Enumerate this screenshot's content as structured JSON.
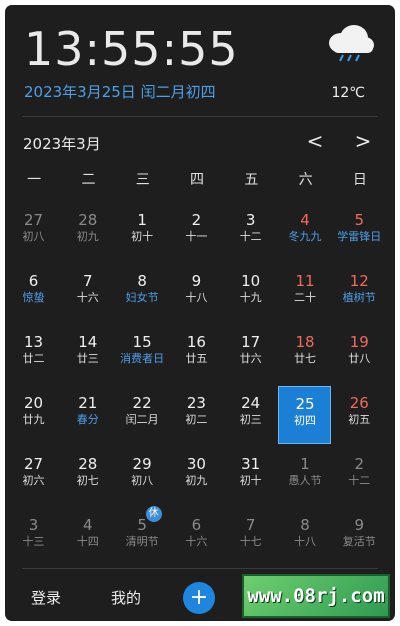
{
  "header": {
    "time": "13:55:55",
    "date": "2023年3月25日 闰二月初四",
    "temperature": "12℃",
    "weather_icon": "cloud-rain-icon"
  },
  "calendar": {
    "month_title": "2023年3月",
    "prev": "<",
    "next": ">",
    "weekdays": [
      "一",
      "二",
      "三",
      "四",
      "五",
      "六",
      "日"
    ],
    "weeks": [
      [
        {
          "d": "27",
          "l": "初八",
          "other": true
        },
        {
          "d": "28",
          "l": "初九",
          "other": true
        },
        {
          "d": "1",
          "l": "初十"
        },
        {
          "d": "2",
          "l": "十一"
        },
        {
          "d": "3",
          "l": "十二"
        },
        {
          "d": "4",
          "l": "冬九九",
          "weekend": true,
          "hl": true
        },
        {
          "d": "5",
          "l": "学雷锋日",
          "weekend": true,
          "hl": true
        }
      ],
      [
        {
          "d": "6",
          "l": "惊蛰",
          "hl": true
        },
        {
          "d": "7",
          "l": "十六"
        },
        {
          "d": "8",
          "l": "妇女节",
          "hl": true
        },
        {
          "d": "9",
          "l": "十八"
        },
        {
          "d": "10",
          "l": "十九"
        },
        {
          "d": "11",
          "l": "二十",
          "weekend": true
        },
        {
          "d": "12",
          "l": "植树节",
          "weekend": true,
          "hl": true
        }
      ],
      [
        {
          "d": "13",
          "l": "廿二"
        },
        {
          "d": "14",
          "l": "廿三"
        },
        {
          "d": "15",
          "l": "消费者日",
          "hl": true
        },
        {
          "d": "16",
          "l": "廿五"
        },
        {
          "d": "17",
          "l": "廿六"
        },
        {
          "d": "18",
          "l": "廿七",
          "weekend": true
        },
        {
          "d": "19",
          "l": "廿八",
          "weekend": true
        }
      ],
      [
        {
          "d": "20",
          "l": "廿九"
        },
        {
          "d": "21",
          "l": "春分",
          "hl": true
        },
        {
          "d": "22",
          "l": "闰二月"
        },
        {
          "d": "23",
          "l": "初二"
        },
        {
          "d": "24",
          "l": "初三"
        },
        {
          "d": "25",
          "l": "初四",
          "today": true
        },
        {
          "d": "26",
          "l": "初五",
          "weekend": true
        }
      ],
      [
        {
          "d": "27",
          "l": "初六"
        },
        {
          "d": "28",
          "l": "初七"
        },
        {
          "d": "29",
          "l": "初八"
        },
        {
          "d": "30",
          "l": "初九"
        },
        {
          "d": "31",
          "l": "初十"
        },
        {
          "d": "1",
          "l": "愚人节",
          "other": true
        },
        {
          "d": "2",
          "l": "十二",
          "other": true
        }
      ],
      [
        {
          "d": "3",
          "l": "十三",
          "other": true
        },
        {
          "d": "4",
          "l": "十四",
          "other": true
        },
        {
          "d": "5",
          "l": "清明节",
          "other": true,
          "badge": "休"
        },
        {
          "d": "6",
          "l": "十六",
          "other": true
        },
        {
          "d": "7",
          "l": "十七",
          "other": true
        },
        {
          "d": "8",
          "l": "十八",
          "other": true
        },
        {
          "d": "9",
          "l": "复活节",
          "other": true
        }
      ]
    ]
  },
  "footer": {
    "login_label": "登录",
    "mine_label": "我的",
    "add_label": "+",
    "watermark": "www.08rj.com"
  }
}
